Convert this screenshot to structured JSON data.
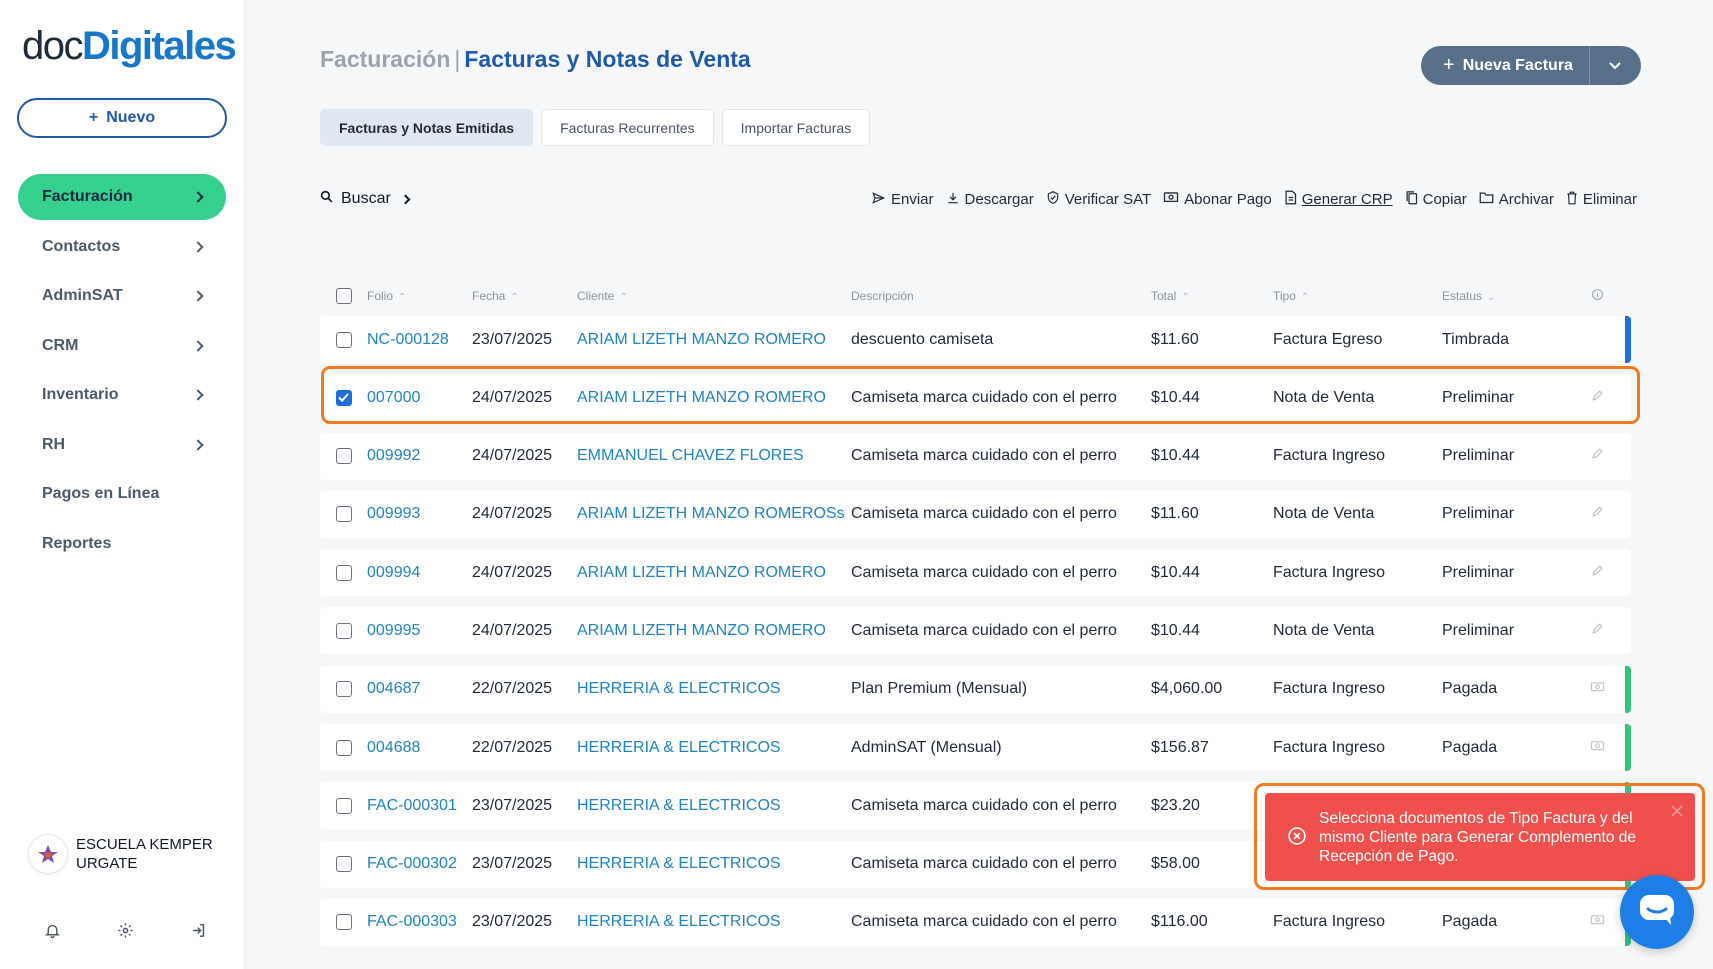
{
  "brand": {
    "part1": "doc",
    "part2": "Digitales",
    "accent": "#1678c8"
  },
  "sidebar": {
    "new_button": "Nuevo",
    "items": [
      {
        "label": "Facturación",
        "chevron": true
      },
      {
        "label": "Contactos",
        "chevron": true
      },
      {
        "label": "AdminSAT",
        "chevron": true
      },
      {
        "label": "CRM",
        "chevron": true
      },
      {
        "label": "Inventario",
        "chevron": true
      },
      {
        "label": "RH",
        "chevron": true
      },
      {
        "label": "Pagos en Línea",
        "chevron": false
      },
      {
        "label": "Reportes",
        "chevron": false
      }
    ],
    "org_name": "ESCUELA KEMPER URGATE",
    "footer_icons": [
      "bell-icon",
      "gear-icon",
      "logout-icon"
    ]
  },
  "header": {
    "section": "Facturación",
    "separator": "|",
    "title": "Facturas y Notas de Venta",
    "new_invoice": "Nueva Factura"
  },
  "tabs": [
    {
      "label": "Facturas y Notas Emitidas",
      "active": true
    },
    {
      "label": "Facturas Recurrentes",
      "active": false
    },
    {
      "label": "Importar Facturas",
      "active": false
    }
  ],
  "search": {
    "label": "Buscar"
  },
  "actions": [
    {
      "label": "Enviar",
      "icon": "send-icon"
    },
    {
      "label": "Descargar",
      "icon": "download-icon"
    },
    {
      "label": "Verificar SAT",
      "icon": "shield-check-icon"
    },
    {
      "label": "Abonar Pago",
      "icon": "money-icon"
    },
    {
      "label": "Generar CRP",
      "icon": "document-icon"
    },
    {
      "label": "Copiar",
      "icon": "copy-icon"
    },
    {
      "label": "Archivar",
      "icon": "folder-icon"
    },
    {
      "label": "Eliminar",
      "icon": "trash-icon"
    }
  ],
  "table": {
    "columns": [
      "Folio",
      "Fecha",
      "Cliente",
      "Descripción",
      "Total",
      "Tipo",
      "Estatus"
    ],
    "rows": [
      {
        "folio": "NC-000128",
        "fecha": "23/07/2025",
        "cliente": "ARIAM LIZETH MANZO ROMERO",
        "descripcion": "descuento camiseta",
        "total": "$11.60",
        "tipo": "Factura Egreso",
        "estatus": "Timbrada",
        "checked": false,
        "action": "none",
        "bar": "#1e6fd9"
      },
      {
        "folio": "007000",
        "fecha": "24/07/2025",
        "cliente": "ARIAM LIZETH MANZO ROMERO",
        "descripcion": "Camiseta marca cuidado con el perro",
        "total": "$10.44",
        "tipo": "Nota de Venta",
        "estatus": "Preliminar",
        "checked": true,
        "action": "edit",
        "bar": ""
      },
      {
        "folio": "009992",
        "fecha": "24/07/2025",
        "cliente": "EMMANUEL CHAVEZ FLORES",
        "descripcion": "Camiseta marca cuidado con el perro",
        "total": "$10.44",
        "tipo": "Factura Ingreso",
        "estatus": "Preliminar",
        "checked": false,
        "action": "edit",
        "bar": ""
      },
      {
        "folio": "009993",
        "fecha": "24/07/2025",
        "cliente": "ARIAM LIZETH MANZO ROMEROSs",
        "descripcion": "Camiseta marca cuidado con el perro",
        "total": "$11.60",
        "tipo": "Nota de Venta",
        "estatus": "Preliminar",
        "checked": false,
        "action": "edit",
        "bar": ""
      },
      {
        "folio": "009994",
        "fecha": "24/07/2025",
        "cliente": "ARIAM LIZETH MANZO ROMERO",
        "descripcion": "Camiseta marca cuidado con el perro",
        "total": "$10.44",
        "tipo": "Factura Ingreso",
        "estatus": "Preliminar",
        "checked": false,
        "action": "edit",
        "bar": ""
      },
      {
        "folio": "009995",
        "fecha": "24/07/2025",
        "cliente": "ARIAM LIZETH MANZO ROMERO",
        "descripcion": "Camiseta marca cuidado con el perro",
        "total": "$10.44",
        "tipo": "Nota de Venta",
        "estatus": "Preliminar",
        "checked": false,
        "action": "edit",
        "bar": ""
      },
      {
        "folio": "004687",
        "fecha": "22/07/2025",
        "cliente": "HERRERIA & ELECTRICOS",
        "descripcion": "Plan Premium (Mensual)",
        "total": "$4,060.00",
        "tipo": "Factura Ingreso",
        "estatus": "Pagada",
        "checked": false,
        "action": "money",
        "bar": "#35c27f"
      },
      {
        "folio": "004688",
        "fecha": "22/07/2025",
        "cliente": "HERRERIA & ELECTRICOS",
        "descripcion": "AdminSAT (Mensual)",
        "total": "$156.87",
        "tipo": "Factura Ingreso",
        "estatus": "Pagada",
        "checked": false,
        "action": "money",
        "bar": "#35c27f"
      },
      {
        "folio": "FAC-000301",
        "fecha": "23/07/2025",
        "cliente": "HERRERIA & ELECTRICOS",
        "descripcion": "Camiseta marca cuidado con el perro",
        "total": "$23.20",
        "tipo": "",
        "estatus": "",
        "checked": false,
        "action": "none",
        "bar": "#35c27f"
      },
      {
        "folio": "FAC-000302",
        "fecha": "23/07/2025",
        "cliente": "HERRERIA & ELECTRICOS",
        "descripcion": "Camiseta marca cuidado con el perro",
        "total": "$58.00",
        "tipo": "",
        "estatus": "",
        "checked": false,
        "action": "none",
        "bar": "#35c27f"
      },
      {
        "folio": "FAC-000303",
        "fecha": "23/07/2025",
        "cliente": "HERRERIA & ELECTRICOS",
        "descripcion": "Camiseta marca cuidado con el perro",
        "total": "$116.00",
        "tipo": "Factura Ingreso",
        "estatus": "Pagada",
        "checked": false,
        "action": "money",
        "bar": "#35c27f"
      }
    ]
  },
  "toast": {
    "message": "Selecciona documentos de Tipo Factura y del mismo Cliente para Generar Complemento de Recepción de Pago.",
    "color": "#f0504b"
  },
  "colors": {
    "active_nav": "#35d08e",
    "link": "#1e84c2",
    "highlight": "#f07a1f"
  }
}
